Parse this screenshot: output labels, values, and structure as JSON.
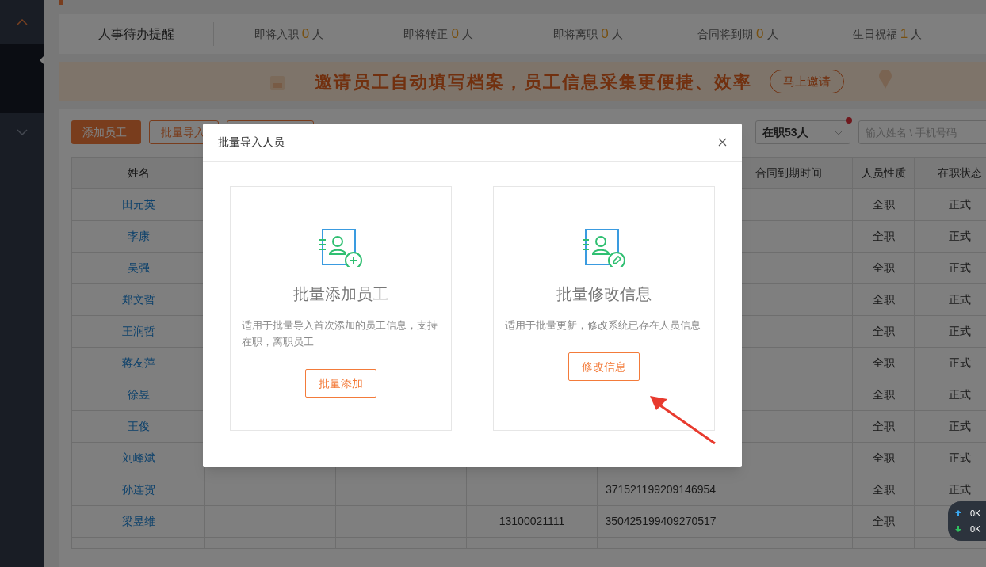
{
  "reminders": {
    "title": "人事待办提醒",
    "items": [
      {
        "label": "即将入职",
        "count": "0",
        "unit": "人"
      },
      {
        "label": "即将转正",
        "count": "0",
        "unit": "人"
      },
      {
        "label": "即将离职",
        "count": "0",
        "unit": "人"
      },
      {
        "label": "合同将到期",
        "count": "0",
        "unit": "人"
      },
      {
        "label": "生日祝福",
        "count": "1",
        "unit": "人"
      }
    ]
  },
  "banner": {
    "text": "邀请员工自动填写档案，员工信息采集更便捷、效率",
    "button": "马上邀请"
  },
  "toolbar": {
    "buttons": [
      {
        "label": "添加员工",
        "primary": true
      },
      {
        "label": "批量导入",
        "primary": false
      }
    ]
  },
  "filter": {
    "value": "在职53人",
    "badge": true
  },
  "search": {
    "placeholder": "输入姓名 \\ 手机号码"
  },
  "table": {
    "columns": {
      "name": "姓名",
      "contract_end": "合同到期时间",
      "type": "人员性质",
      "status": "在职状态"
    },
    "rows": [
      {
        "name": "田元英",
        "type": "全职",
        "status": "正式"
      },
      {
        "name": "李康",
        "type": "全职",
        "status": "正式"
      },
      {
        "name": "吴强",
        "type": "全职",
        "status": "正式"
      },
      {
        "name": "郑文哲",
        "type": "全职",
        "status": "正式"
      },
      {
        "name": "王润哲",
        "type": "全职",
        "status": "正式"
      },
      {
        "name": "蒋友萍",
        "type": "全职",
        "status": "正式"
      },
      {
        "name": "徐昱",
        "type": "全职",
        "status": "正式"
      },
      {
        "name": "王俊",
        "type": "全职",
        "status": "正式"
      },
      {
        "name": "刘峰斌",
        "type": "全职",
        "status": "正式"
      },
      {
        "name": "孙连贺",
        "id_number": "371521199209146954",
        "type": "全职",
        "status": "正式"
      },
      {
        "name": "梁昱维",
        "phone": "13100021111",
        "id_number": "350425199409270517",
        "type": "全职"
      }
    ]
  },
  "modal": {
    "title": "批量导入人员",
    "options": [
      {
        "kind": "add",
        "title": "批量添加员工",
        "description": "适用于批量导入首次添加的员工信息，支持在职，离职员工",
        "button": "批量添加"
      },
      {
        "kind": "edit",
        "title": "批量修改信息",
        "description": "适用于批量更新，修改系统已存在人员信息",
        "button": "修改信息"
      }
    ]
  },
  "net_widget": {
    "upload": "0K",
    "download": "0K"
  }
}
